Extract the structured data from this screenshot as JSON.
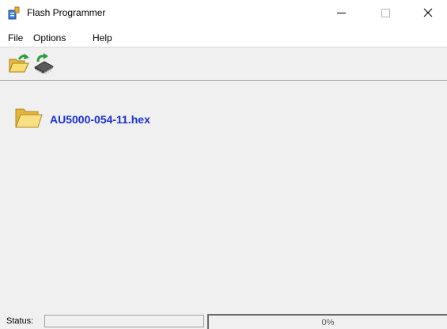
{
  "window": {
    "title": "Flash Programmer"
  },
  "menu": {
    "items": [
      {
        "label": "File"
      },
      {
        "label": "Options"
      },
      {
        "label": "Help"
      }
    ]
  },
  "toolbar": {
    "buttons": [
      {
        "icon": "open-folder-arrow-icon"
      },
      {
        "icon": "program-chip-icon"
      }
    ]
  },
  "main": {
    "file_icon": "folder-icon",
    "file_name": "AU5000-054-11.hex"
  },
  "status": {
    "label": "Status:",
    "text": "",
    "progress_fraction": 0,
    "progress_text": "0%"
  },
  "colors": {
    "file_name": "#1a2fd8",
    "background": "#f0f0f0",
    "folder_yellow": "#f5d56a",
    "accent_green": "#2e9c3e"
  }
}
